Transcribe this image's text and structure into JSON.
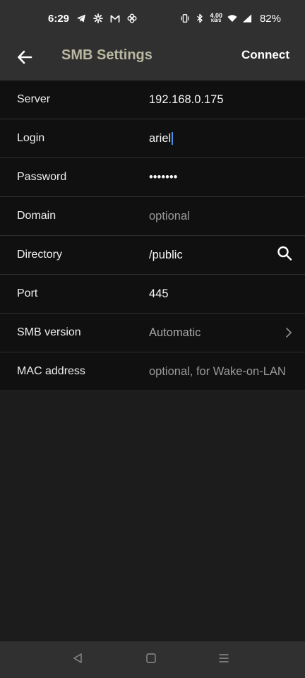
{
  "status_bar": {
    "time": "6:29",
    "net_speed_value": "4.00",
    "net_speed_unit": "KB/S",
    "battery": "82%"
  },
  "app_bar": {
    "title": "SMB Settings",
    "connect_label": "Connect"
  },
  "fields": [
    {
      "label": "Server",
      "value": "192.168.0.175"
    },
    {
      "label": "Login",
      "value": "ariel"
    },
    {
      "label": "Password",
      "value": "•••••••"
    },
    {
      "label": "Domain",
      "placeholder": "optional"
    },
    {
      "label": "Directory",
      "value": "/public"
    },
    {
      "label": "Port",
      "value": "445"
    },
    {
      "label": "SMB version",
      "value": "Automatic"
    },
    {
      "label": "MAC address",
      "placeholder": "optional, for Wake-on-LAN"
    }
  ],
  "colors": {
    "title": "#b9b79f",
    "cursor": "#4a90e2",
    "bar_background": "#303030",
    "row_background": "#101010"
  },
  "icons": {
    "back": "arrow-left-icon",
    "search": "search-icon",
    "chevron": "chevron-right-icon"
  }
}
